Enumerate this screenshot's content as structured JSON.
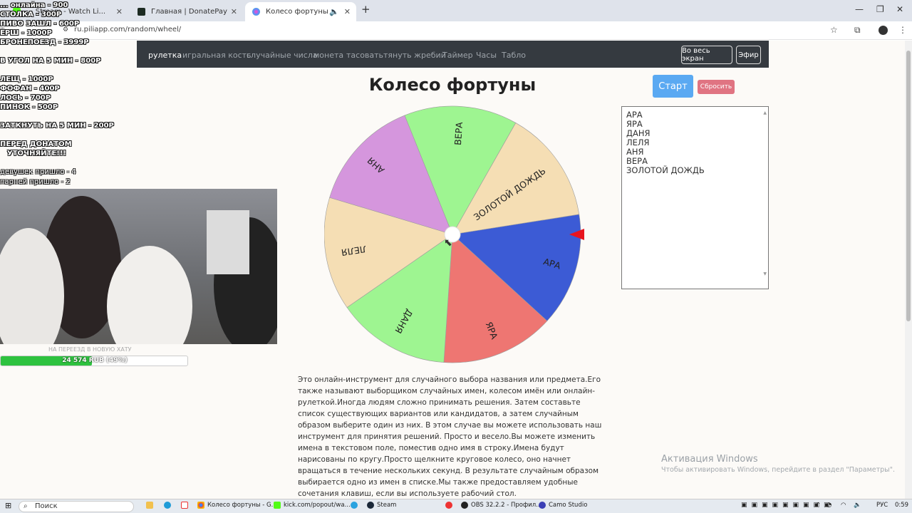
{
  "browser": {
    "tabs": [
      {
        "label": "... Stream - Watch Li...",
        "active": false
      },
      {
        "label": "Главная | DonatePay",
        "active": false
      },
      {
        "label": "Колесо фортуны",
        "active": true
      }
    ],
    "url": "ru.piliapp.com/random/wheel/"
  },
  "nav": {
    "links": [
      "рулетка",
      "игральная кость",
      "случайные числа",
      "монета",
      "тасовать",
      "тянуть жребий",
      "Таймер",
      "Часы",
      "Табло"
    ],
    "fullscreen_label": "Во весь экран",
    "air_label": "Эфир"
  },
  "page": {
    "title": "Колесо фортуны",
    "start_label": "Старт",
    "reset_label": "Сбросить",
    "names": [
      "АРА",
      "ЯРА",
      "ДАНЯ",
      "ЛЕЛЯ",
      "АНЯ",
      "ВЕРА",
      "ЗОЛОТОЙ ДОЖДЬ"
    ],
    "description": "Это онлайн-инструмент для случайного выбора названия или предмета.Его также называют выборщиком случайных имен, колесом имён или онлайн-рулеткой.Иногда людям сложно принимать решения. Затем составьте список существующих вариантов или кандидатов, а затем случайным образом выберите один из них. В этом случае вы можете использовать наш инструмент для принятия решений. Просто и весело.Вы можете изменить имена в текстовом поле, поместив одно имя в строку.Имена будут нарисованы по кругу.Просто щелкните круговое колесо, оно начнет вращаться в течение нескольких секунд. В результате случайным образом выбирается одно из имен в списке.Мы также предоставляем удобные сочетания клавиш, если вы используете рабочий стол."
  },
  "wheel": {
    "segments": [
      {
        "label": "АРА",
        "color": "#3c5bd5"
      },
      {
        "label": "ЯРА",
        "color": "#ee7672"
      },
      {
        "label": "ДАНЯ",
        "color": "#9ef591"
      },
      {
        "label": "ЛЕЛЯ",
        "color": "#f5deb4"
      },
      {
        "label": "АНЯ",
        "color": "#d596dd"
      },
      {
        "label": "ВЕРА",
        "color": "#9ef591"
      },
      {
        "label": "ЗОЛОТОЙ ДОЖДЬ",
        "color": "#f5deb4"
      }
    ],
    "pointer_color": "#e8141e"
  },
  "overlay": {
    "lines": [
      "... онлайна - 900",
      "СТОЛКА - 300Р",
      "ПИВО ЗАШЛ - 600Р",
      "ЁРШ - 1000Р",
      "БРОНЕПОЕЗД - 3999Р",
      "В УГОЛ НА 5 МИН - 800Р",
      "ЛЕЩ - 1000Р",
      "ФОФАН - 400Р",
      "ЛОСЬ - 700Р",
      "ПИНОК - 500Р",
      "ЗАТКНУТЬ НА 5 МИН - 200Р",
      "ПЕРЕД ДОНАТОМ",
      "УТОЧНЯЙТЕ!!!",
      "девушек пришло - 4",
      "парней пришло - 2"
    ],
    "goal_title": "НА ПЕРЕЕЗД В НОВУЮ ХАТУ",
    "goal_text": "24 574 RUB (49%)",
    "goal_percent": 49
  },
  "windows": {
    "activation_title": "Активация Windows",
    "activation_sub": "Чтобы активировать Windows, перейдите в раздел \"Параметры\"."
  },
  "taskbar": {
    "search_placeholder": "Поиск",
    "apps": [
      "Колесо фортуны - G...",
      "kick.com/popout/wa...",
      "Steam",
      "OBS 32.2.2 - Профил...",
      "Camo Studio"
    ],
    "lang": "РУС",
    "time": "0:59"
  }
}
